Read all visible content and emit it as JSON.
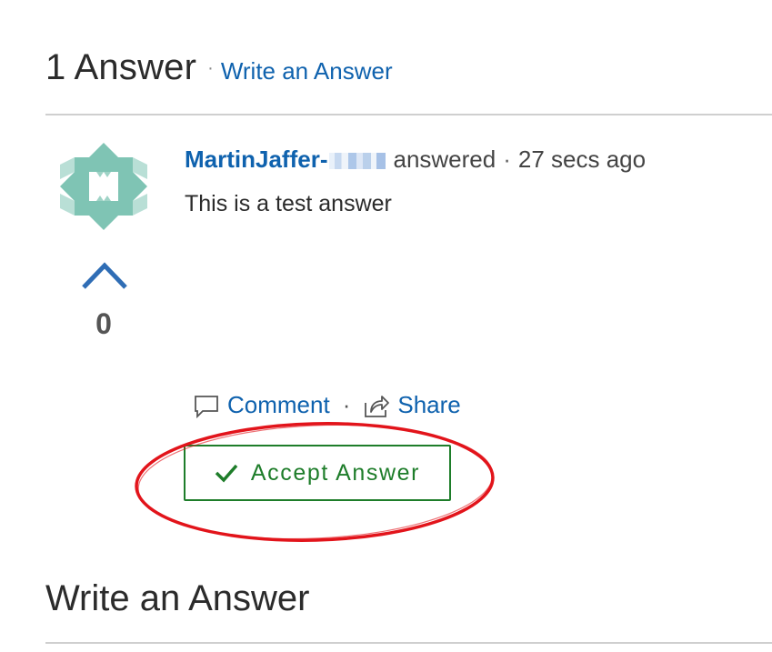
{
  "answers_header": {
    "count_label": "1 Answer",
    "separator": "·",
    "write_link": "Write an Answer"
  },
  "answer": {
    "avatar_icon": "identicon-avatar",
    "vote_count": "0",
    "author": "MartinJaffer-",
    "answered_label": "answered",
    "time_separator": "·",
    "time_ago": "27 secs ago",
    "body": "This is a test answer",
    "actions": {
      "comment_label": "Comment",
      "separator": "·",
      "share_label": "Share"
    },
    "accept_button_label": "Accept Answer"
  },
  "write_section": {
    "title": "Write an Answer"
  },
  "colors": {
    "link_blue": "#0f62ae",
    "accept_green": "#1e7d2a",
    "highlight_red": "#e2141b",
    "avatar_teal": "#7fc4b4"
  }
}
